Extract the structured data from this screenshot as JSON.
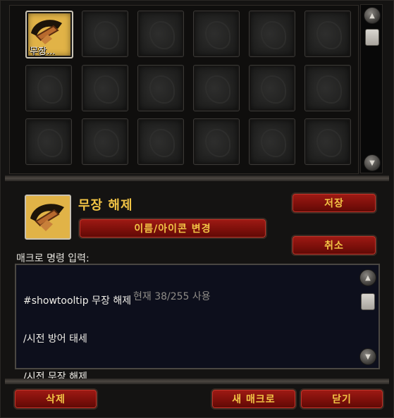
{
  "slots": {
    "selected_label": "무장..."
  },
  "macro": {
    "name": "무장 해제",
    "change_name_icon_label": "이름/아이콘 변경",
    "save_label": "저장",
    "cancel_label": "취소",
    "command_label": "매크로 명령 입력:",
    "lines": [
      "#showtooltip 무장 해제",
      "/시전 방어 태세",
      "/시전 무장 해제"
    ],
    "char_count": "현재 38/255 사용"
  },
  "footer": {
    "delete_label": "삭제",
    "new_macro_label": "새 매크로",
    "close_label": "닫기"
  },
  "colors": {
    "button_red": "#8a130e",
    "button_text": "#f2c445",
    "editor_bg": "#0d0f1c"
  },
  "icons": {
    "macro_icon": "axe-disarm-icon",
    "scroll_up": "arrow-up-icon",
    "scroll_down": "arrow-down-icon"
  }
}
